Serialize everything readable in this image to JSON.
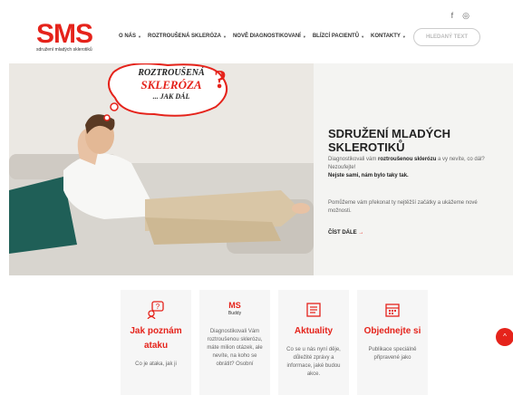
{
  "header": {
    "logo_mark": "SMS",
    "logo_sub": "sdružení mladých sklerotiků",
    "nav": [
      {
        "label": "O NÁS"
      },
      {
        "label": "ROZTROUŠENÁ SKLERÓZA"
      },
      {
        "label": "NOVĚ DIAGNOSTIKOVANÍ"
      },
      {
        "label": "BLÍZCÍ PACIENTŮ"
      },
      {
        "label": "KONTAKTY"
      }
    ],
    "search_placeholder": "HLEDANÝ TEXT",
    "social": {
      "facebook": "f",
      "instagram": "◎"
    }
  },
  "hero": {
    "bubble_line1": "ROZTROUŠENÁ",
    "bubble_line2": "SKLERÓZA",
    "bubble_line3": "... JAK DÁL",
    "bubble_mark": "?",
    "title": "SDRUŽENÍ MLADÝCH SKLEROTIKŮ",
    "text_lead": "Diagnostikovali vám ",
    "text_bold": "roztroušenou sklerózu",
    "text_tail": " a vy nevíte, co dál? Nezoufejte!",
    "text_strong": "Nejste sami, nám bylo taky tak.",
    "text2": "Pomůžeme vám překonat ty nejtěžší začátky a ukážeme nové možnosti.",
    "link_label": "ČÍST DÁLE",
    "link_arrow": "→"
  },
  "cards": [
    {
      "title": "Jak poznám ataku",
      "text": "Co je ataka, jak ji",
      "icon": "question-bubble-icon"
    },
    {
      "logo": "MS",
      "logo_sub": "Buddy",
      "text": "Diagnostikovali Vám roztroušenou sklerózu, máte milion otázek, ale nevíte, na koho se obrátit? Osobní",
      "icon": "ms-buddy-logo"
    },
    {
      "title": "Aktuality",
      "text": "Co se u nás nyní děje, důležité zprávy a informace, jaké budou akce.",
      "icon": "newspaper-icon"
    },
    {
      "title": "Objednejte si",
      "text": "Publikace speciálně připravené jako",
      "icon": "calendar-icon"
    }
  ],
  "scroll_top": "^",
  "colors": {
    "accent": "#e5231b"
  }
}
